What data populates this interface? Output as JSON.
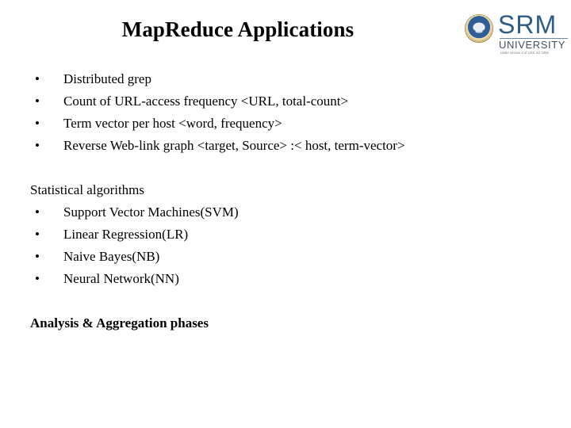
{
  "slide": {
    "title": "MapReduce Applications",
    "background_color": "#ffffff",
    "text_color": "#000000"
  },
  "logo": {
    "name": "SRM University",
    "wordmark": "SRM",
    "subtitle": "UNIVERSITY",
    "tagline": "Under section 3 of UGC Act 1956",
    "wordmark_color": "#2e5b8a",
    "subtitle_color": "#44505c",
    "emblem_ring_color": "#cdb071",
    "emblem_center_color": "#2f5d96"
  },
  "content": {
    "bullet_marker": "•",
    "applications": [
      "Distributed grep",
      "Count of URL-access frequency <URL, total-count>",
      "Term vector per host <word, frequency>",
      "Reverse Web-link graph <target, Source> :< host, term-vector>"
    ],
    "statistical_heading": "Statistical algorithms",
    "statistical_algorithms": [
      "Support Vector Machines(SVM)",
      "Linear Regression(LR)",
      "Naive Bayes(NB)",
      "Neural Network(NN)"
    ],
    "closing_line": "Analysis & Aggregation phases"
  }
}
